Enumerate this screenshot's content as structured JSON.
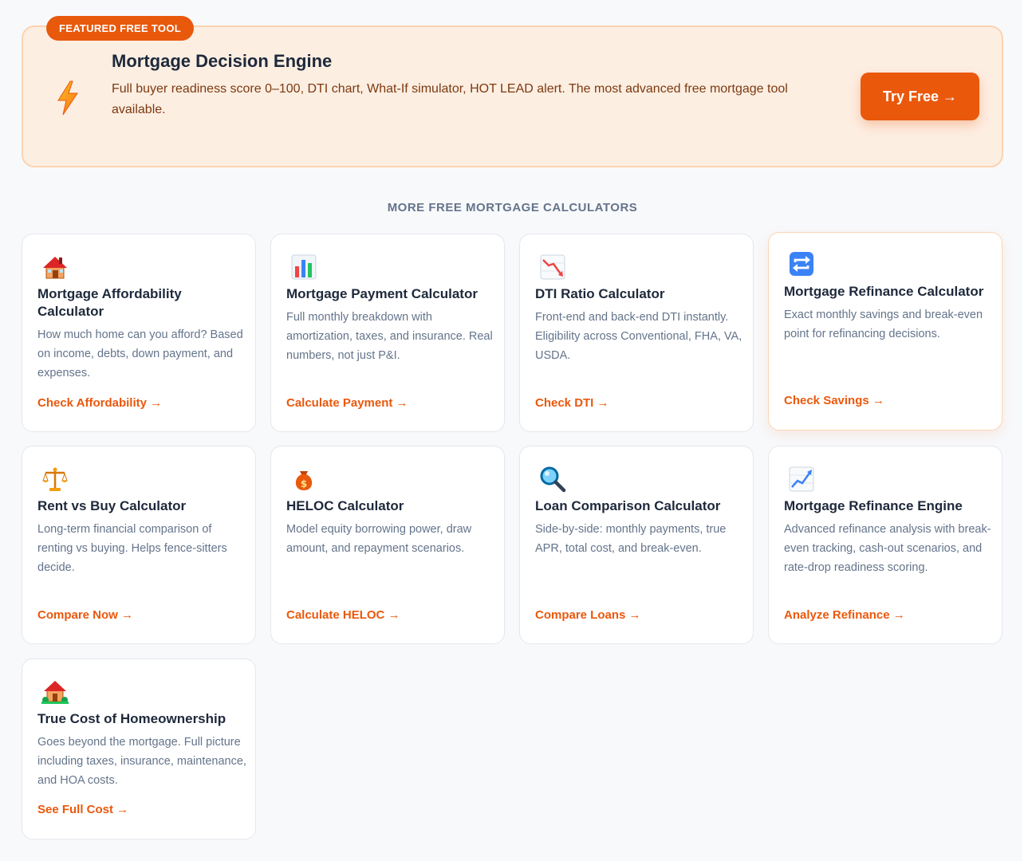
{
  "featured": {
    "badge": "FEATURED FREE TOOL",
    "icon": "lightning-icon",
    "title": "Mortgage Decision Engine",
    "description": "Full buyer readiness score 0–100, DTI chart, What-If simulator, HOT LEAD alert. The most advanced free mortgage tool available.",
    "cta": "Try Free →"
  },
  "section_heading": "MORE FREE MORTGAGE CALCULATORS",
  "colors": {
    "accent": "#ea580c",
    "featured_bg": "#fdeee2",
    "card_border": "#e5e7eb",
    "text_muted": "#64748b"
  },
  "cards": [
    {
      "icon": "house-icon",
      "title": "Mortgage Affordability Calculator",
      "description": "How much home can you afford? Based on income, debts, down payment, and expenses.",
      "link": "Check Affordability →"
    },
    {
      "icon": "bar-chart-icon",
      "title": "Mortgage Payment Calculator",
      "description": "Full monthly breakdown with amortization, taxes, and insurance. Real numbers, not just P&I.",
      "link": "Calculate Payment →"
    },
    {
      "icon": "chart-decreasing-icon",
      "title": "DTI Ratio Calculator",
      "description": "Front-end and back-end DTI instantly. Eligibility across Conventional, FHA, VA, USDA.",
      "link": "Check DTI →"
    },
    {
      "icon": "repeat-arrows-icon",
      "title": "Mortgage Refinance Calculator",
      "description": "Exact monthly savings and break-even point for refinancing decisions.",
      "link": "Check Savings →"
    },
    {
      "icon": "balance-scale-icon",
      "title": "Rent vs Buy Calculator",
      "description": "Long-term financial comparison of renting vs buying. Helps fence-sitters decide.",
      "link": "Compare Now →"
    },
    {
      "icon": "money-bag-icon",
      "title": "HELOC Calculator",
      "description": "Model equity borrowing power, draw amount, and repayment scenarios.",
      "link": "Calculate HELOC →"
    },
    {
      "icon": "magnifier-icon",
      "title": "Loan Comparison Calculator",
      "description": "Side-by-side: monthly payments, true APR, total cost, and break-even.",
      "link": "Compare Loans →"
    },
    {
      "icon": "chart-increasing-icon",
      "title": "Mortgage Refinance Engine",
      "description": "Advanced refinance analysis with break-even tracking, cash-out scenarios, and rate-drop readiness scoring.",
      "link": "Analyze Refinance →"
    },
    {
      "icon": "house-garden-icon",
      "title": "True Cost of Homeownership",
      "description": "Goes beyond the mortgage. Full picture including taxes, insurance, maintenance, and HOA costs.",
      "link": "See Full Cost →"
    }
  ]
}
